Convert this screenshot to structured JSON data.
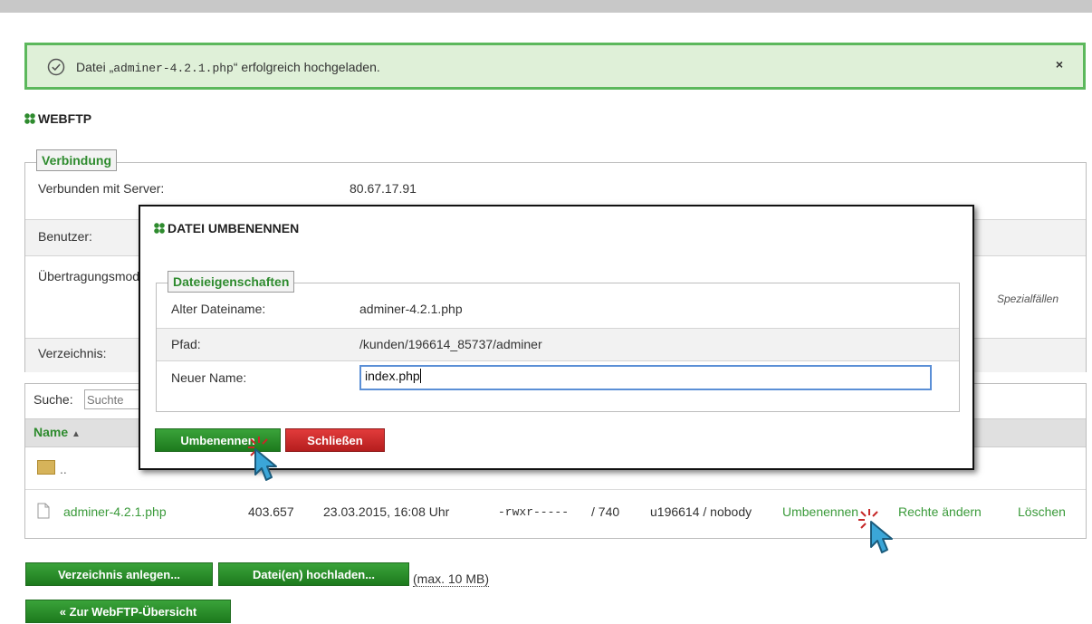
{
  "alert": {
    "prefix": "Datei „",
    "filename": "adminer-4.2.1.php",
    "suffix": "“ erfolgreich hochgeladen.",
    "close": "×"
  },
  "page": {
    "title": "WEBFTP"
  },
  "connection": {
    "legend": "Verbindung",
    "rows": [
      {
        "label": "Verbunden mit Server:",
        "value": "80.67.17.91"
      },
      {
        "label": "Benutzer:",
        "value": ""
      },
      {
        "label": "Übertragungsmodus:",
        "value": "",
        "note": "Spezialfällen"
      },
      {
        "label": "Verzeichnis:",
        "value": ""
      }
    ]
  },
  "list": {
    "search_label": "Suche:",
    "search_placeholder": "Suchte",
    "name_header": "Name",
    "sort_icon": "▲",
    "parent_dir": "..",
    "file": {
      "name": "adminer-4.2.1.php",
      "size": "403.657",
      "date": "23.03.2015, 16:08 Uhr",
      "perms": "-rwxr-----",
      "octal": "/ 740",
      "owner": "u196614 / nobody",
      "actions": [
        "Umbenennen",
        "Rechte ändern",
        "Löschen"
      ]
    }
  },
  "footer": {
    "mkdir_label": "Verzeichnis anlegen...",
    "upload_label": "Datei(en) hochladen...",
    "max_note": "(max. 10 MB)",
    "back_label": "« Zur WebFTP-Übersicht"
  },
  "dialog": {
    "title": "DATEI UMBENENNEN",
    "legend": "Dateieigenschaften",
    "old_name_label": "Alter Dateiname:",
    "old_name_value": "adminer-4.2.1.php",
    "path_label": "Pfad:",
    "path_value": "/kunden/196614_85737/adminer",
    "new_name_label": "Neuer Name:",
    "new_name_value": "index.php",
    "rename_label": "Umbenennen",
    "close_label": "Schließen"
  },
  "colors": {
    "accent": "#2e8b2e",
    "danger": "#c62828",
    "success_border": "#5cb85c",
    "success_bg": "#dff0d8"
  }
}
